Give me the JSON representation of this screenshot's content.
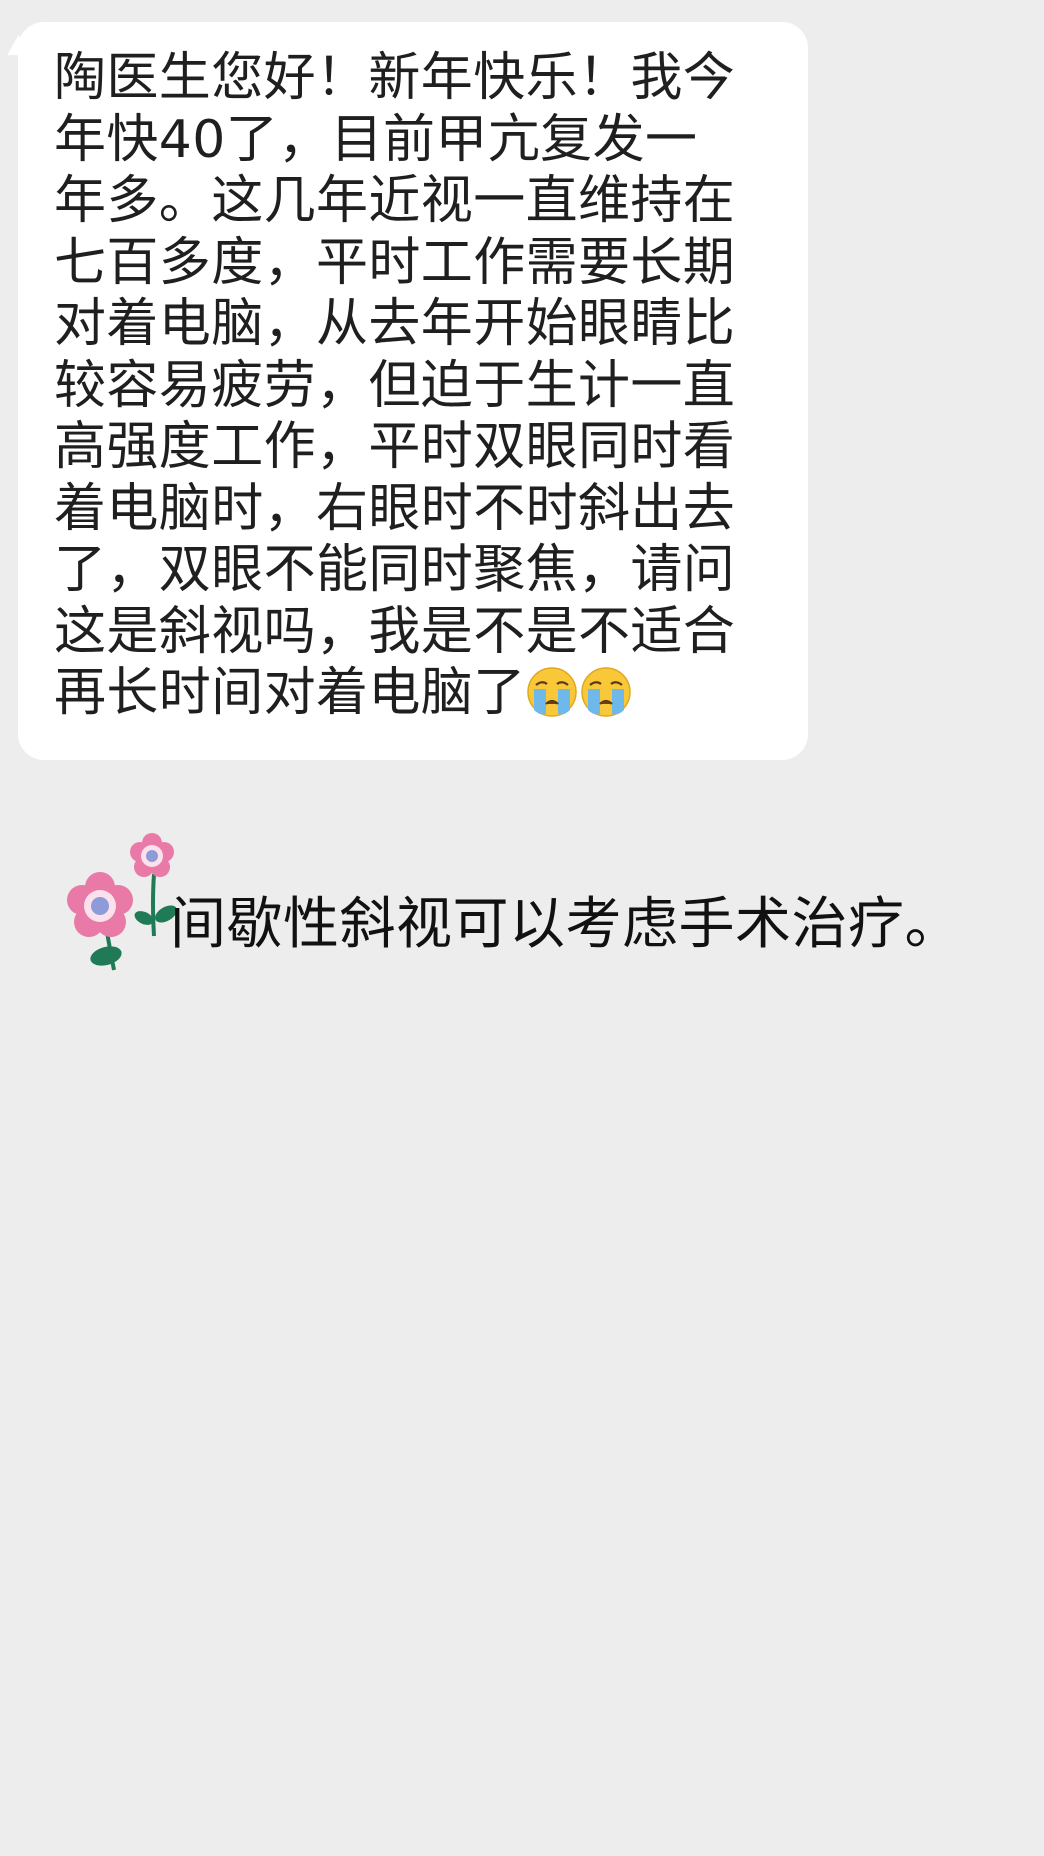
{
  "conversation": {
    "incoming_message": {
      "text": "陶医生您好！新年快乐！我今\n年快40了，目前甲亢复发一\n年多。这几年近视一直维持在\n七百多度，平时工作需要长期\n对着电脑，从去年开始眼睛比\n较容易疲劳，但迫于生计一直\n高强度工作，平时双眼同时看\n着电脑时，右眼时不时斜出去\n了，双眼不能同时聚焦，请问\n这是斜视吗，我是不是不适合\n再长时间对着电脑了",
      "trailing_emojis": [
        "loudly-crying-face-emoji",
        "loudly-crying-face-emoji"
      ]
    },
    "reply_message": {
      "sticker": "pink-flower-sticker",
      "text": "间歇性斜视可以考虑手术治疗。"
    }
  },
  "colors": {
    "background": "#ededed",
    "incoming_bubble": "#ffffff",
    "text": "#1f1f1f",
    "flower_pink": "#e97aa8",
    "flower_center": "#8e9bd8",
    "stem_green": "#1f7a55"
  }
}
